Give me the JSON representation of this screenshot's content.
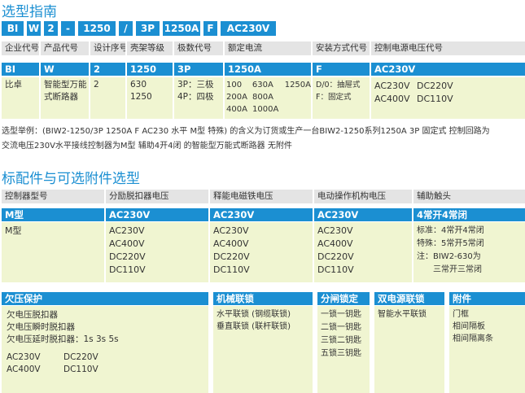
{
  "titles": {
    "selection": "选型指南",
    "accessories": "标配件与可选附件选型"
  },
  "code": [
    "BI",
    "W",
    "2",
    "-",
    "1250",
    "/",
    "3P",
    "1250A",
    "F",
    "AC230V"
  ],
  "t1": {
    "headers": [
      "企业代号",
      "产品代号",
      "设计序号",
      "壳架等级",
      "极数代号",
      "额定电流",
      "安装方式代号",
      "控制电源电压代号"
    ],
    "codes": [
      "BI",
      "W",
      "2",
      "1250",
      "3P",
      "1250A",
      "F",
      "AC230V"
    ],
    "c0": [
      "比卓"
    ],
    "c1": [
      "智能型万能",
      "式断路器"
    ],
    "c2": [
      "2"
    ],
    "c3": [
      "630",
      "1250"
    ],
    "c4": [
      "3P：三极",
      "4P：四极"
    ],
    "c5": [
      [
        "100",
        "630A",
        "1250A"
      ],
      [
        "200A",
        "800A",
        ""
      ],
      [
        "400A",
        "1000A",
        ""
      ]
    ],
    "c6": [
      "D/0：抽屉式",
      "F：固定式"
    ],
    "c7": [
      [
        "AC230V",
        "DC220V"
      ],
      [
        "AC400V",
        "DC110V"
      ]
    ]
  },
  "example": {
    "line1": "选型举例：(BIW2-1250/3P 1250A F AC230 水平 M型 特殊) 的含义为订货或生产一台BIW2-1250系列1250A  3P 固定式 控制回路为",
    "line2": "交流电压230V水平接线控制器为M型 辅助4开4闭 的智能型万能式断路器 无附件"
  },
  "t2": {
    "headers": [
      "控制器型号",
      "分励脱扣器电压",
      "释能电磁铁电压",
      "电动操作机构电压",
      "辅助触头"
    ],
    "codes": [
      "M型",
      "AC230V",
      "AC230V",
      "AC230V",
      "4常开4常闭"
    ],
    "c0": [
      "M型"
    ],
    "c1": [
      "AC230V",
      "AC400V",
      "DC220V",
      "DC110V"
    ],
    "c2": [
      "AC230V",
      "AC400V",
      "DC220V",
      "DC110V"
    ],
    "c3": [
      "AC230V",
      "AC400V",
      "DC220V",
      "DC110V"
    ],
    "c4": [
      "标准：4常开4常闭",
      "特殊：5常开5常闭",
      "注：BIW2-630为",
      "三常开三常闭"
    ]
  },
  "t3": {
    "headers": [
      "欠压保护",
      "机械联锁",
      "分闸锁定",
      "双电源联锁",
      "附件"
    ],
    "c0": [
      "欠电压脱扣器",
      "欠电压瞬时脱扣器",
      "欠电压延时脱扣器：1s   3s    5s"
    ],
    "c0_volts": [
      [
        "AC230V",
        "DC220V"
      ],
      [
        "AC400V",
        "DC110V"
      ]
    ],
    "c1": [
      "水平联锁 (钢缆联锁)",
      "垂直联锁 (联杆联锁)"
    ],
    "c2": [
      "一锁一钥匙",
      "二锁一钥匙",
      "三锁二钥匙",
      "五锁三钥匙"
    ],
    "c3": [
      "智能水平联锁"
    ],
    "c4": [
      "门框",
      "相间隔板",
      "相间隔离条"
    ]
  }
}
